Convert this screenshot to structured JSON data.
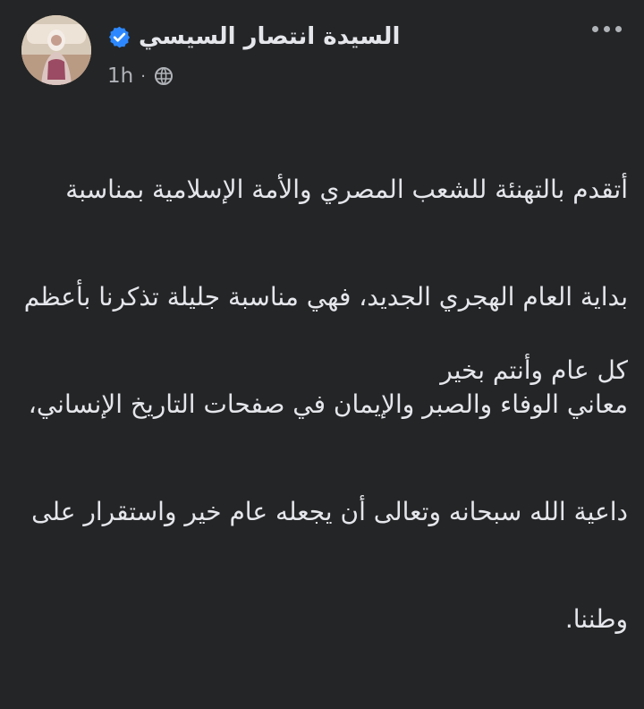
{
  "post": {
    "author": {
      "name": "السيدة انتصار السيسي"
    },
    "meta": {
      "time": "1h",
      "separator": "·"
    },
    "body_lines": [
      "أتقدم بالتهنئة للشعب المصري والأمة الإسلامية بمناسبة",
      "بداية العام الهجري الجديد، فهي مناسبة جليلة تذكرنا بأعظم",
      "معاني الوفاء والصبر والإيمان في صفحات التاريخ الإنساني،",
      "داعية الله سبحانه وتعالى أن يجعله عام خير واستقرار على",
      "وطننا."
    ],
    "closing": "كل عام وأنتم بخير"
  },
  "colors": {
    "background": "#242526",
    "primary_text": "#e4e6eb",
    "secondary_text": "#b0b3b8",
    "verified_badge": "#2d88ff"
  },
  "icons": {
    "menu": "three-dots-icon",
    "verified": "verified-badge-icon",
    "audience": "globe-icon"
  }
}
